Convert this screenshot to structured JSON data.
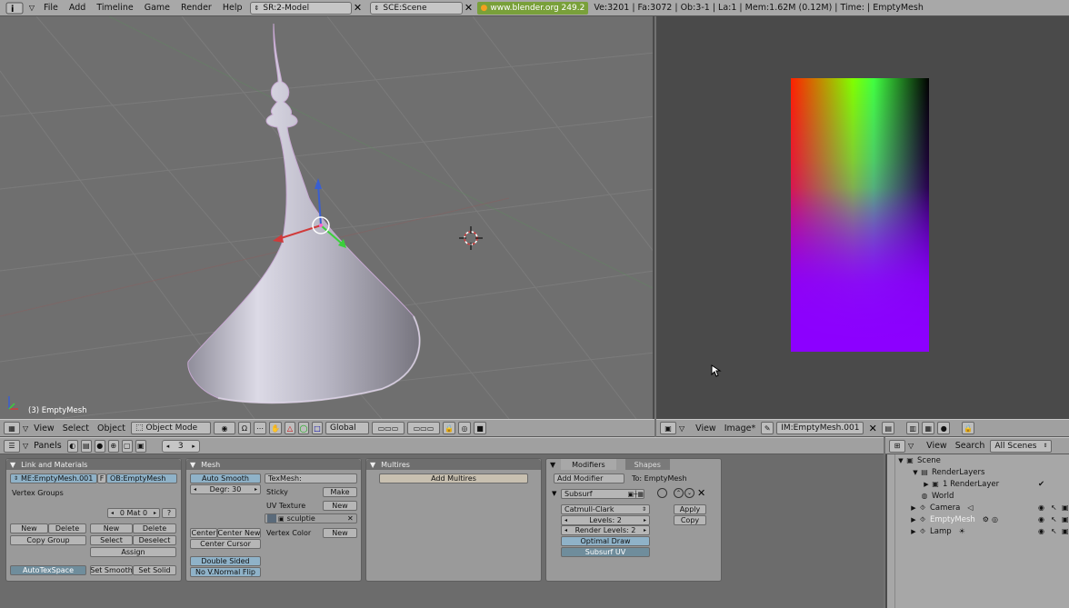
{
  "topbar": {
    "menus": [
      "File",
      "Add",
      "Timeline",
      "Game",
      "Render",
      "Help"
    ],
    "screen_field": "SR:2-Model",
    "scene_field": "SCE:Scene",
    "website_badge": "www.blender.org 249.2",
    "stats": "Ve:3201 | Fa:3072 | Ob:3-1 | La:1  | Mem:1.62M (0.12M)  | Time: | EmptyMesh"
  },
  "viewport": {
    "object_label": "(3) EmptyMesh",
    "colors": {
      "background": "#6f6f6f",
      "grid": "#7a7a7a",
      "mesh": "#b8b6c4"
    }
  },
  "viewport_header": {
    "view": "View",
    "select": "Select",
    "object": "Object",
    "mode": "Object Mode",
    "orientation": "Global"
  },
  "image_header": {
    "view": "View",
    "image": "Image*",
    "image_name": "IM:EmptyMesh.001"
  },
  "buttons_header": {
    "panels": "Panels",
    "frame": "3"
  },
  "outliner_header": {
    "view": "View",
    "search": "Search",
    "scope": "All Scenes"
  },
  "link_materials": {
    "title": "Link and Materials",
    "mesh_name": "ME:EmptyMesh.001",
    "f": "F",
    "object_name": "OB:EmptyMesh",
    "vertex_groups": "Vertex Groups",
    "mat_counter": "0 Mat 0",
    "question": "?",
    "new1": "New",
    "delete1": "Delete",
    "copy_group": "Copy Group",
    "new2": "New",
    "delete2": "Delete",
    "select": "Select",
    "deselect": "Deselect",
    "assign": "Assign",
    "autotexspace": "AutoTexSpace",
    "set_smooth": "Set Smooth",
    "set_solid": "Set Solid"
  },
  "mesh_panel": {
    "title": "Mesh",
    "auto_smooth": "Auto Smooth",
    "degr": "Degr: 30",
    "texmesh": "TexMesh:",
    "sticky": "Sticky",
    "make": "Make",
    "uv_texture": "UV Texture",
    "new_uv": "New",
    "uv_name": "sculptie",
    "vertex_color": "Vertex Color",
    "new_vc": "New",
    "center": "Center",
    "center_new": "Center New",
    "center_cursor": "Center Cursor",
    "double_sided": "Double Sided",
    "no_vnormal_flip": "No V.Normal Flip"
  },
  "multires": {
    "title": "Multires",
    "add_multires": "Add Multires"
  },
  "modifiers": {
    "tab_modifiers": "Modifiers",
    "tab_shapes": "Shapes",
    "add_modifier": "Add Modifier",
    "to": "To: EmptyMesh",
    "subsurf": "Subsurf",
    "type": "Catmull-Clark",
    "levels": "Levels: 2",
    "render_levels": "Render Levels: 2",
    "optimal_draw": "Optimal Draw",
    "subsurf_uv": "Subsurf UV",
    "apply": "Apply",
    "copy": "Copy"
  },
  "outliner": {
    "items": [
      {
        "label": "Scene",
        "indent": 0
      },
      {
        "label": "RenderLayers",
        "indent": 1
      },
      {
        "label": "1 RenderLayer",
        "indent": 2
      },
      {
        "label": "World",
        "indent": 1
      },
      {
        "label": "Camera",
        "indent": 1
      },
      {
        "label": "EmptyMesh",
        "indent": 1
      },
      {
        "label": "Lamp",
        "indent": 1
      }
    ]
  }
}
